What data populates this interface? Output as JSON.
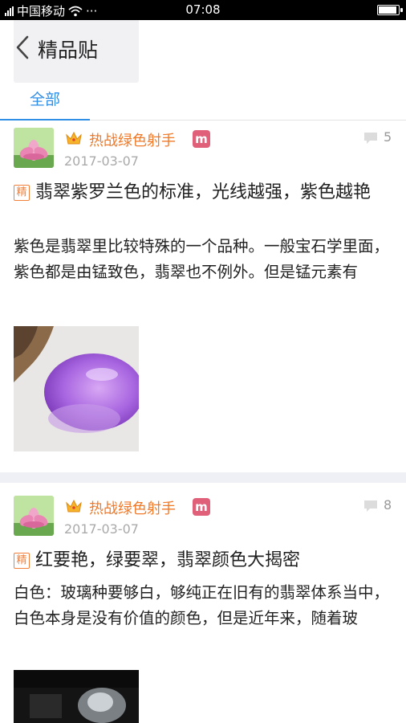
{
  "status_bar": {
    "carrier": "中国移动",
    "dots": "···",
    "time": "07:08"
  },
  "header": {
    "title": "精品贴"
  },
  "tabs": [
    {
      "label": "全部",
      "active": true
    }
  ],
  "colors": {
    "accent": "#2f8ee6",
    "username": "#f07a2a",
    "badge": "#e0607a",
    "jing": "#f3803a"
  },
  "posts": [
    {
      "username": "热战绿色射手",
      "level_badge": "m",
      "comment_count": "5",
      "date": "2017-03-07",
      "tag": "精",
      "title": "翡翠紫罗兰色的标准，光线越强，紫色越艳",
      "excerpt": "紫色是翡翠里比较特殊的一个品种。一般宝石学里面，紫色都是由锰致色，翡翠也不例外。但是锰元素有"
    },
    {
      "username": "热战绿色射手",
      "level_badge": "m",
      "comment_count": "8",
      "date": "2017-03-07",
      "tag": "精",
      "title": "红要艳，绿要翠，翡翠颜色大揭密",
      "excerpt": "白色：玻璃种要够白，够纯正在旧有的翡翠体系当中，白色本身是没有价值的颜色，但是近年来，随着玻"
    }
  ]
}
